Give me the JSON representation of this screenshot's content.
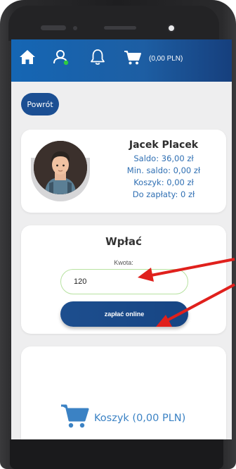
{
  "navbar": {
    "icons": [
      "home-icon",
      "user-icon",
      "bell-icon",
      "cart-icon"
    ],
    "cart_label": "(0,00 PLN)",
    "status_dot_color": "#2ecc40",
    "accent": "#1566b4"
  },
  "back_label": "Powrót",
  "profile": {
    "name": "Jacek Placek",
    "saldo": "Saldo: 36,00 zł",
    "min_saldo": "Min. saldo: 0,00 zł",
    "koszyk": "Koszyk: 0,00 zł",
    "do_zaplaty": "Do zapłaty: 0 zł"
  },
  "payment": {
    "title": "Wpłać",
    "amount_label": "Kwota:",
    "amount_value": "120",
    "pay_button": "zapłać online"
  },
  "cart": {
    "label": "Koszyk (0,00 PLN)",
    "icon": "cart-icon",
    "color": "#3b82c4"
  },
  "annotation_color": "#e0201c"
}
